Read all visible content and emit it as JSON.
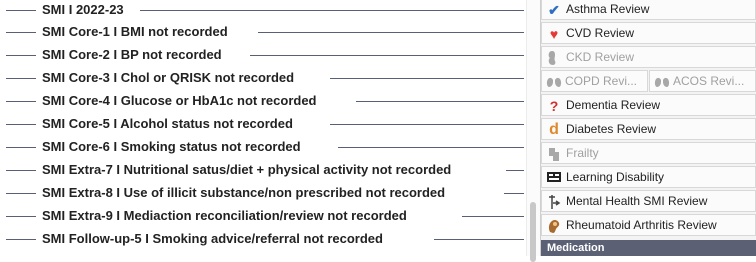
{
  "tree": {
    "rows": [
      "SMI I 2022-23",
      "SMI Core-1 I BMI not recorded",
      "SMI Core-2 I BP not recorded",
      "SMI Core-3 I Chol or QRISK not recorded",
      "SMI Core-4 I Glucose or HbA1c not recorded",
      "SMI Core-5 I Alcohol status not recorded",
      "SMI Core-6 I Smoking status not recorded",
      "SMI Extra-7 I Nutritional satus/diet + physical activity not recorded",
      "SMI Extra-8 I Use of illicit substance/non prescribed not recorded",
      "SMI Extra-9 I Mediaction reconciliation/review not recorded",
      "SMI Follow-up-5 I Smoking advice/referral not recorded"
    ]
  },
  "reviews": {
    "asthma": "Asthma Review",
    "cvd": "CVD Review",
    "ckd": "CKD Review",
    "copd": "COPD Revi...",
    "acos": "ACOS Revi...",
    "dementia": "Dementia Review",
    "diabetes": "Diabetes Review",
    "frailty": "Frailty",
    "learning": "Learning Disability",
    "mental_health": "Mental Health SMI Review",
    "rheumatoid": "Rheumatoid Arthritis Review"
  },
  "section_header": "Medication",
  "colors": {
    "asthma_check": "#2f6fc0",
    "cvd_heart": "#e53935",
    "dementia_q": "#d32f2f",
    "diabetes_d": "#e08a2e",
    "header_bg": "#5b6075"
  },
  "icons": {
    "asthma": "check-icon",
    "cvd": "heart-icon",
    "ckd": "kidney-icon",
    "copd": "lungs-icon",
    "acos": "lungs-icon",
    "dementia": "question-icon",
    "diabetes": "d-letter-icon",
    "frailty": "frailty-icon",
    "learning": "learning-icon",
    "mental_health": "mental-health-icon",
    "rheumatoid": "rheumatoid-icon"
  }
}
